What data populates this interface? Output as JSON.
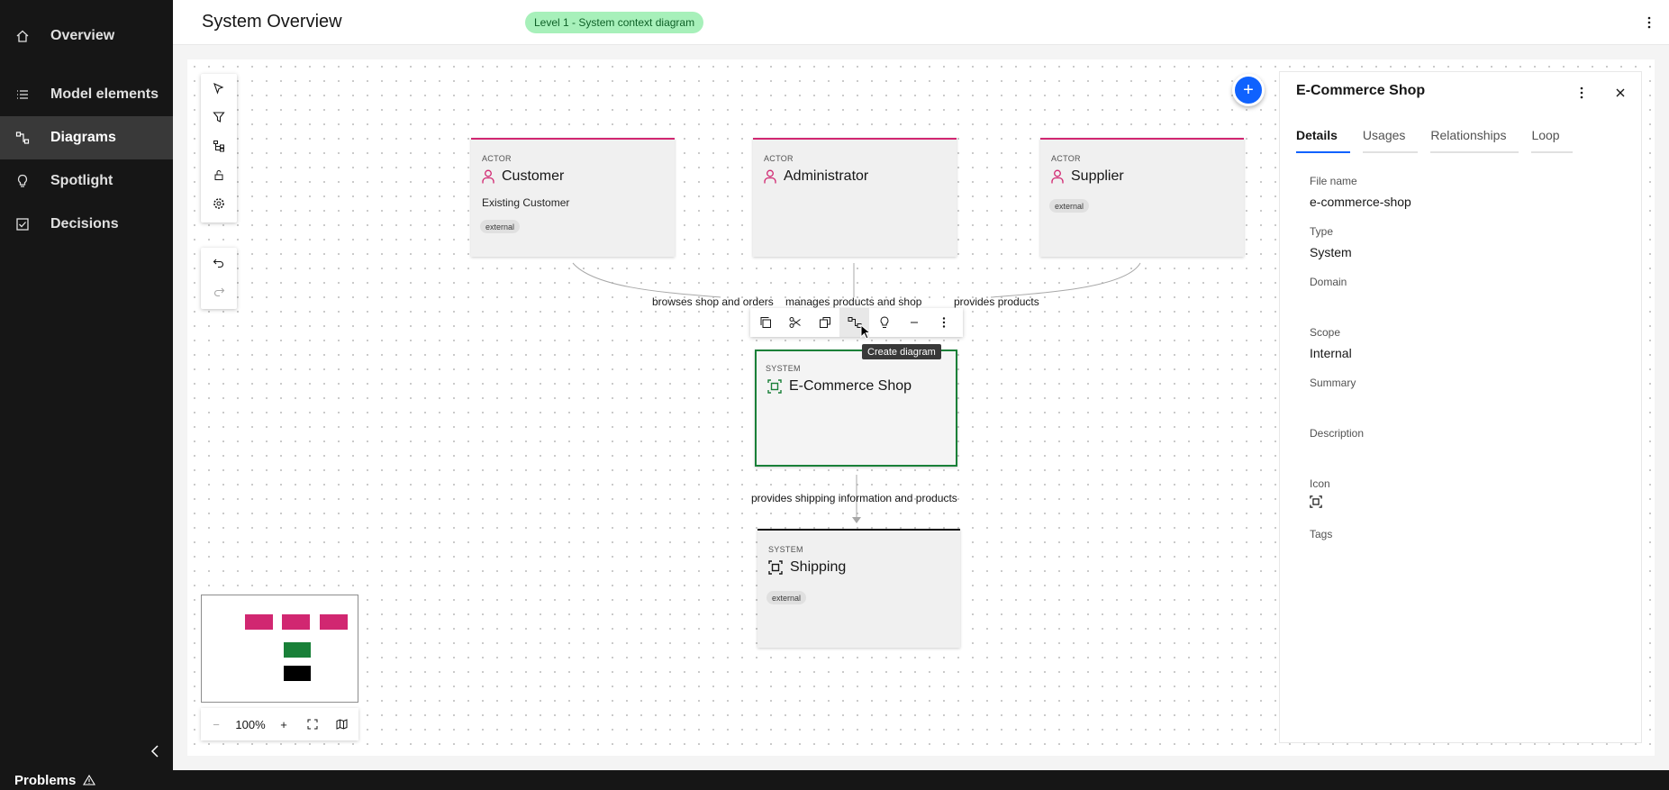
{
  "sidebar": {
    "items": [
      {
        "label": "Overview",
        "icon": "home-icon"
      },
      {
        "label": "Model elements",
        "icon": "list-icon"
      },
      {
        "label": "Diagrams",
        "icon": "diagram-icon"
      },
      {
        "label": "Spotlight",
        "icon": "lightbulb-icon"
      },
      {
        "label": "Decisions",
        "icon": "checkbox-icon"
      }
    ],
    "active": "Diagrams"
  },
  "header": {
    "title": "System Overview",
    "badge": "Level 1 - System context diagram"
  },
  "diagram": {
    "nodes": {
      "customer": {
        "kind": "ACTOR",
        "name": "Customer",
        "subtitle": "Existing Customer",
        "tag": "external"
      },
      "administrator": {
        "kind": "ACTOR",
        "name": "Administrator"
      },
      "supplier": {
        "kind": "ACTOR",
        "name": "Supplier",
        "tag": "external"
      },
      "ecommerce": {
        "kind": "SYSTEM",
        "name": "E-Commerce Shop"
      },
      "shipping": {
        "kind": "SYSTEM",
        "name": "Shipping",
        "tag": "external"
      }
    },
    "edges": {
      "customer": "browses shop and orders",
      "administrator": "manages products and shop",
      "supplier": "provides products",
      "shipping": "provides shipping information and products"
    },
    "tooltip": "Create diagram"
  },
  "zoom": {
    "level": "100%",
    "plus": "+"
  },
  "panel": {
    "title": "E-Commerce Shop",
    "tabs": [
      "Details",
      "Usages",
      "Relationships",
      "Loop"
    ],
    "fields": {
      "file_name_label": "File name",
      "file_name": "e-commerce-shop",
      "type_label": "Type",
      "type": "System",
      "domain_label": "Domain",
      "scope_label": "Scope",
      "scope": "Internal",
      "summary_label": "Summary",
      "description_label": "Description",
      "icon_label": "Icon",
      "tags_label": "Tags"
    }
  },
  "footer": {
    "problems": "Problems"
  },
  "colors": {
    "actor": "#d12771",
    "system_selected": "#198038",
    "system_ext": "#161616",
    "accent": "#0f62fe",
    "badge_bg": "#a7f0ba"
  }
}
